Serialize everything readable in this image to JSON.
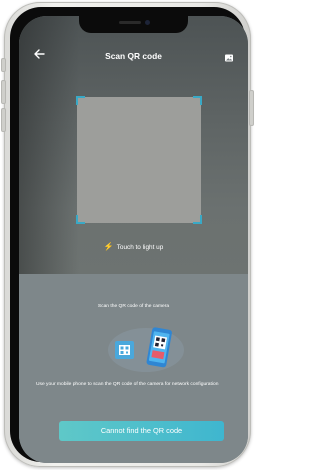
{
  "header": {
    "title": "Scan QR code",
    "back_icon": "arrow-left-icon",
    "album_icon": "image-icon"
  },
  "scanner": {
    "flashlight_label": "Touch to light up",
    "flashlight_icon": "lightning-bolt-icon",
    "accent_color": "#39a9c6"
  },
  "guide": {
    "instruction": "Scan the QR code of the camera",
    "help_text": "Use your mobile phone to scan the QR code of the camera for network configuration"
  },
  "actions": {
    "cannot_find_label": "Cannot find the QR code"
  }
}
